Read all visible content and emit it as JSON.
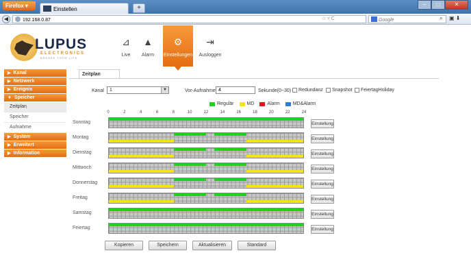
{
  "browser": {
    "menu_button": "Firefox",
    "tab_title": "Einstellen",
    "new_tab": "+",
    "url": "192.168.0.87",
    "search_placeholder": "Google"
  },
  "brand": {
    "name": "LUPUS",
    "sub": "ELECTRONICS",
    "tagline": "BREAKS YOUR LIFE"
  },
  "topnav": [
    {
      "label": "Live",
      "icon": "camera-icon"
    },
    {
      "label": "Alarm",
      "icon": "bell-icon"
    },
    {
      "label": "Einstellungen",
      "icon": "gear-icon"
    },
    {
      "label": "Ausloggen",
      "icon": "logout-icon"
    }
  ],
  "sidebar": {
    "kanal": "Kanal",
    "netzwerk": "Netzwerk",
    "ereignis": "Ereignis",
    "speicher": "Speicher",
    "speicher_items": [
      "Zeitplan",
      "Speicher",
      "Aufnahme"
    ],
    "system": "System",
    "erweitert": "Erweitert",
    "information": "Information"
  },
  "page": {
    "tab": "Zeitplan"
  },
  "form": {
    "kanal_label": "Kanal",
    "kanal_value": "1",
    "pre_record_label": "Vor-Aufnahme",
    "pre_record_value": "4",
    "pre_record_unit": "Sekunde(0~30)",
    "redundancy": "Redundanz",
    "snapshot": "Snapshot",
    "holiday": "FeiertagHoliday"
  },
  "legend": [
    {
      "label": "Regulär",
      "color": "#22d022"
    },
    {
      "label": "MD",
      "color": "#f4e21a"
    },
    {
      "label": "Alarm",
      "color": "#e8141e"
    },
    {
      "label": "MD&Alarm",
      "color": "#2a7fd0"
    }
  ],
  "hours": [
    "0",
    "2",
    "4",
    "6",
    "8",
    "10",
    "12",
    "14",
    "16",
    "18",
    "20",
    "22",
    "24"
  ],
  "schedule": {
    "settings_label": "Einstellung",
    "days": [
      {
        "name": "Sonntag",
        "periods": [
          {
            "type": "regular",
            "from": 0,
            "to": 24
          }
        ]
      },
      {
        "name": "Montag",
        "periods": [
          {
            "type": "md",
            "from": 0,
            "to": 8
          },
          {
            "type": "regular",
            "from": 8,
            "to": 12
          },
          {
            "type": "regular",
            "from": 13,
            "to": 17
          },
          {
            "type": "md",
            "from": 17,
            "to": 24
          }
        ]
      },
      {
        "name": "Dienstag",
        "periods": [
          {
            "type": "md",
            "from": 0,
            "to": 8
          },
          {
            "type": "regular",
            "from": 8,
            "to": 12
          },
          {
            "type": "regular",
            "from": 13,
            "to": 17
          },
          {
            "type": "md",
            "from": 17,
            "to": 24
          }
        ]
      },
      {
        "name": "Mittwoch",
        "periods": [
          {
            "type": "md",
            "from": 0,
            "to": 8
          },
          {
            "type": "regular",
            "from": 8,
            "to": 12
          },
          {
            "type": "regular",
            "from": 13,
            "to": 17
          },
          {
            "type": "md",
            "from": 17,
            "to": 24
          }
        ]
      },
      {
        "name": "Donnerstag",
        "periods": [
          {
            "type": "md",
            "from": 0,
            "to": 8
          },
          {
            "type": "regular",
            "from": 8,
            "to": 12
          },
          {
            "type": "regular",
            "from": 13,
            "to": 17
          },
          {
            "type": "md",
            "from": 17,
            "to": 24
          }
        ]
      },
      {
        "name": "Freitag",
        "periods": [
          {
            "type": "md",
            "from": 0,
            "to": 8
          },
          {
            "type": "regular",
            "from": 8,
            "to": 12
          },
          {
            "type": "regular",
            "from": 13,
            "to": 17
          },
          {
            "type": "md",
            "from": 17,
            "to": 24
          }
        ]
      },
      {
        "name": "Samstag",
        "periods": [
          {
            "type": "regular",
            "from": 0,
            "to": 24
          }
        ]
      },
      {
        "name": "Feiertag",
        "periods": [
          {
            "type": "regular",
            "from": 0,
            "to": 24
          }
        ]
      }
    ]
  },
  "actions": {
    "copy": "Kopieren",
    "save": "Speichern",
    "refresh": "Aktualisieren",
    "default": "Standard"
  }
}
